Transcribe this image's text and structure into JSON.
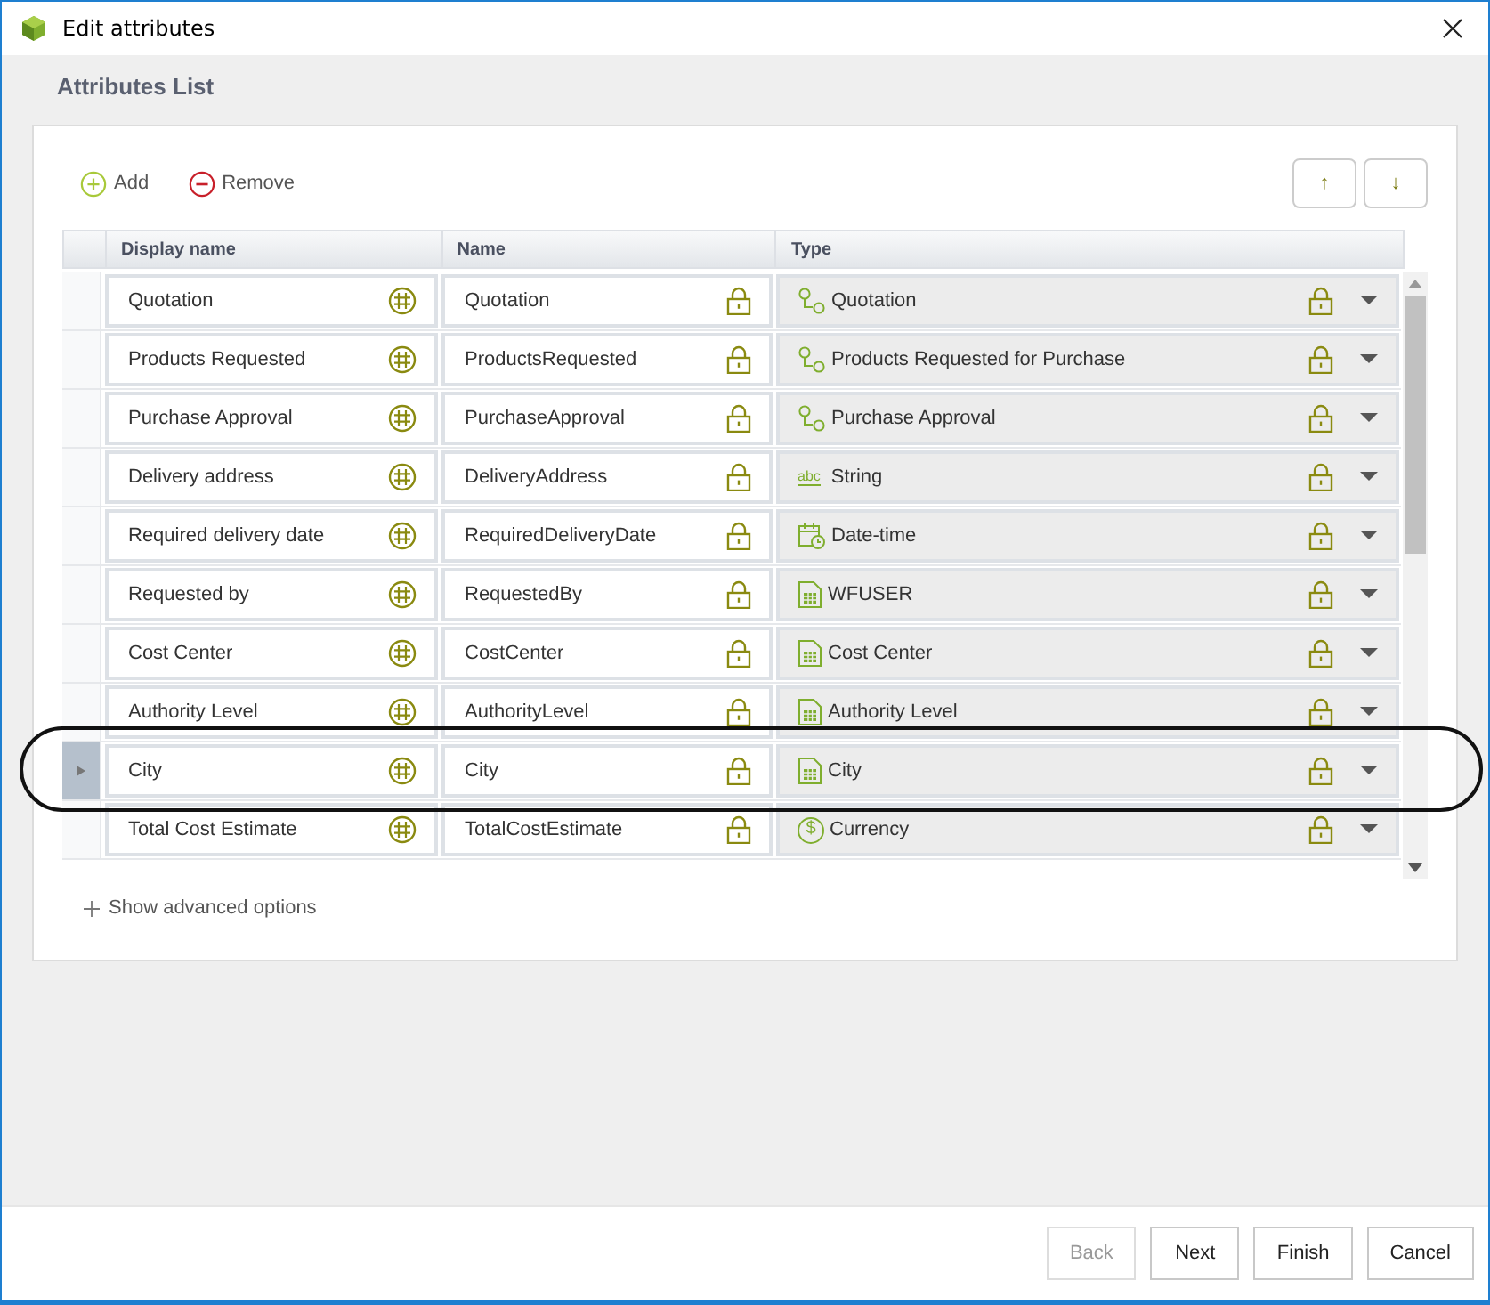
{
  "window": {
    "title": "Edit attributes"
  },
  "section_title": "Attributes List",
  "toolbar": {
    "add": "Add",
    "remove": "Remove",
    "move_up": "↑",
    "move_down": "↓"
  },
  "table": {
    "columns": [
      "Display name",
      "Name",
      "Type"
    ],
    "rows": [
      {
        "display_name": "Quotation",
        "name": "Quotation",
        "type": "Quotation",
        "kind": "process",
        "selected": false
      },
      {
        "display_name": "Products Requested",
        "name": "ProductsRequested",
        "type": "Products Requested for Purchase",
        "kind": "process",
        "selected": false
      },
      {
        "display_name": "Purchase Approval",
        "name": "PurchaseApproval",
        "type": "Purchase Approval",
        "kind": "process",
        "selected": false
      },
      {
        "display_name": "Delivery address",
        "name": "DeliveryAddress",
        "type": "String",
        "kind": "string",
        "icon_text": "abc",
        "selected": false
      },
      {
        "display_name": "Required delivery date",
        "name": "RequiredDeliveryDate",
        "type": "Date-time",
        "kind": "datetime",
        "selected": false
      },
      {
        "display_name": "Requested by",
        "name": "RequestedBy",
        "type": "WFUSER",
        "kind": "table",
        "selected": false
      },
      {
        "display_name": "Cost Center",
        "name": "CostCenter",
        "type": "Cost Center",
        "kind": "table",
        "selected": false
      },
      {
        "display_name": "Authority Level",
        "name": "AuthorityLevel",
        "type": "Authority Level",
        "kind": "table",
        "selected": false
      },
      {
        "display_name": "City",
        "name": "City",
        "type": "City",
        "kind": "table",
        "selected": true
      },
      {
        "display_name": "Total Cost Estimate",
        "name": "TotalCostEstimate",
        "type": "Currency",
        "kind": "currency",
        "icon_text": "$",
        "selected": false
      }
    ]
  },
  "advanced_link": "Show advanced options",
  "buttons": [
    {
      "label": "Back",
      "disabled": true
    },
    {
      "label": "Next",
      "disabled": false
    },
    {
      "label": "Finish",
      "disabled": false
    },
    {
      "label": "Cancel",
      "disabled": false
    }
  ]
}
